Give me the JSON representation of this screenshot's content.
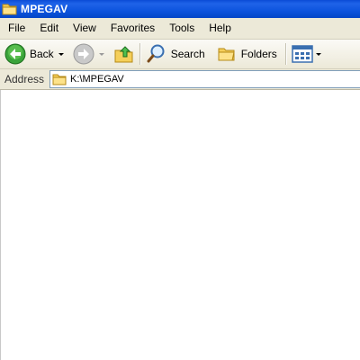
{
  "window": {
    "title": "MPEGAV"
  },
  "menu": {
    "items": [
      "File",
      "Edit",
      "View",
      "Favorites",
      "Tools",
      "Help"
    ]
  },
  "toolbar": {
    "back_label": "Back",
    "search_label": "Search",
    "folders_label": "Folders"
  },
  "address": {
    "label": "Address",
    "value": "K:\\MPEGAV"
  },
  "colors": {
    "titlebar": "#0d54de",
    "chrome": "#ece9d8",
    "content": "#ffffff"
  }
}
